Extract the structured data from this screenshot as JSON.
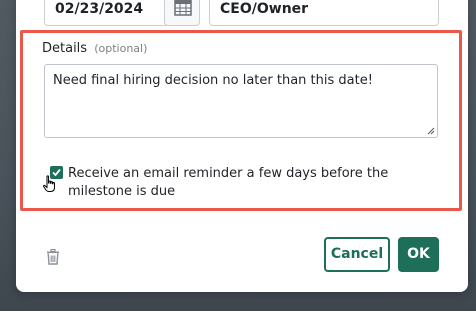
{
  "top_fields": {
    "date_value": "02/23/2024",
    "owner_value": "CEO/Owner"
  },
  "details": {
    "label": "Details",
    "optional_hint": "(optional)",
    "text": "Need final hiring decision no later than this date!"
  },
  "reminder": {
    "checked": true,
    "label": "Receive an email reminder a few days before the milestone is due"
  },
  "actions": {
    "cancel_label": "Cancel",
    "ok_label": "OK"
  },
  "colors": {
    "accent": "#1d6f5a",
    "highlight": "#e9584a"
  }
}
